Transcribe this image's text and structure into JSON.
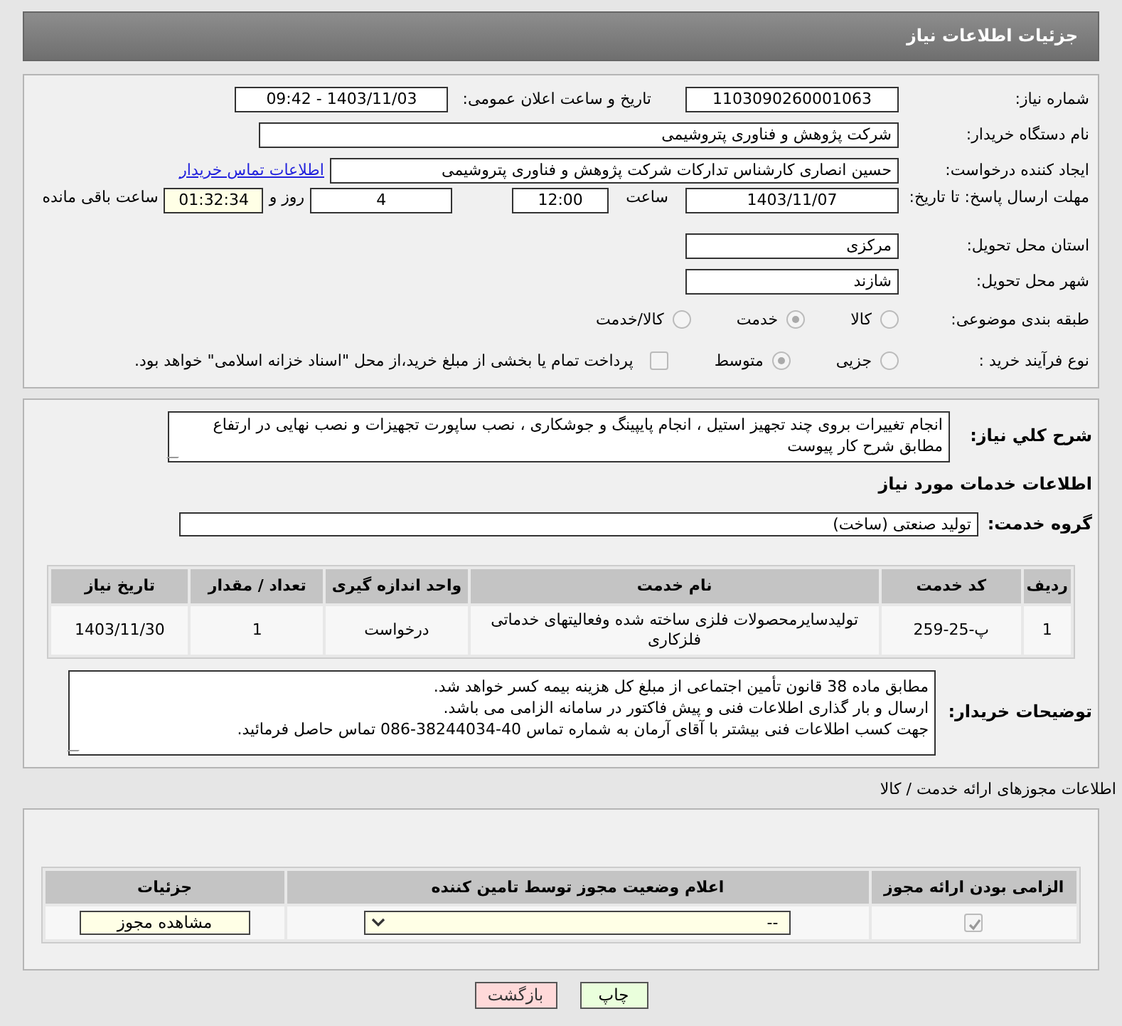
{
  "header": {
    "title": "جزئیات اطلاعات نیاز"
  },
  "need_number": {
    "label": "شماره نیاز:",
    "value": "1103090260001063"
  },
  "announce": {
    "label": "تاریخ و ساعت اعلان عمومی:",
    "value": "1403/11/03 - 09:42"
  },
  "buyer_org": {
    "label": "نام دستگاه خریدار:",
    "value": "شرکت پژوهش و فناوری پتروشیمی"
  },
  "requester": {
    "label": "ایجاد کننده درخواست:",
    "value": "حسین انصاری کارشناس تدارکات شرکت پژوهش و فناوری پتروشیمی",
    "link": "اطلاعات تماس خریدار"
  },
  "deadline": {
    "label": "مهلت ارسال پاسخ: تا تاریخ:",
    "date": "1403/11/07",
    "time_label": "ساعت",
    "time": "12:00",
    "days": "4",
    "days_label": "روز و",
    "remaining": "01:32:34",
    "remaining_label": "ساعت باقی مانده"
  },
  "province": {
    "label": "استان محل تحویل:",
    "value": "مرکزی"
  },
  "city": {
    "label": "شهر محل تحویل:",
    "value": "شازند"
  },
  "category": {
    "label": "طبقه بندی موضوعی:",
    "options": [
      {
        "label": "کالا",
        "selected": false
      },
      {
        "label": "خدمت",
        "selected": true
      },
      {
        "label": "کالا/خدمت",
        "selected": false
      }
    ]
  },
  "process": {
    "label": "نوع فرآیند خرید :",
    "options": [
      {
        "label": "جزیی",
        "selected": false
      },
      {
        "label": "متوسط",
        "selected": true
      }
    ],
    "payment": {
      "checked": false,
      "text": "پرداخت تمام یا بخشی از مبلغ خرید،از محل \"اسناد خزانه اسلامی\" خواهد بود."
    }
  },
  "description": {
    "label": "شرح کلي نياز:",
    "value": "انجام تغییرات بروی چند تجهیز استیل ، انجام پایپینگ و جوشکاری ، نصب ساپورت تجهیزات و نصب نهایی در ارتفاع مطابق شرح کار پیوست"
  },
  "services_heading": "اطلاعات خدمات مورد نیاز",
  "service_group": {
    "label": "گروه خدمت:",
    "value": "تولید صنعتی (ساخت)"
  },
  "services_table": {
    "columns": [
      "ردیف",
      "کد خدمت",
      "نام خدمت",
      "واحد اندازه گیری",
      "تعداد / مقدار",
      "تاریخ نیاز"
    ],
    "rows": [
      [
        "1",
        "پ-25-259",
        "تولیدسایرمحصولات فلزی ساخته شده وفعالیتهای خدماتی فلزکاری",
        "درخواست",
        "1",
        "1403/11/30"
      ]
    ]
  },
  "buyer_notes": {
    "label": "توضیحات خریدار:",
    "lines": [
      "مطابق ماده 38 قانون تأمین اجتماعی از مبلغ کل هزینه بیمه کسر خواهد شد.",
      "ارسال و بار گذاری اطلاعات فنی و پیش فاکتور در سامانه الزامی می باشد.",
      "جهت کسب اطلاعات فنی بیشتر با آقای آرمان به شماره تماس  40-38244034-086 تماس حاصل فرمائید."
    ]
  },
  "permits_title": "اطلاعات مجوزهای ارائه خدمت / کالا",
  "permits_table": {
    "columns": [
      "الزامی بودن ارائه مجوز",
      "اعلام وضعیت مجوز توسط تامین کننده",
      "جزئیات"
    ],
    "rows": [
      {
        "required": true,
        "status": "--",
        "action": "مشاهده مجوز"
      }
    ]
  },
  "buttons": [
    {
      "kind": "print",
      "label": "چاپ"
    },
    {
      "kind": "back",
      "label": "بازگشت"
    }
  ]
}
